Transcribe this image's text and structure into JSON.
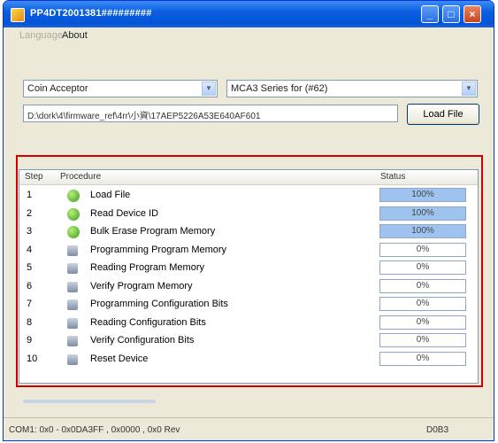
{
  "window": {
    "title": "PP4DT2001381#########"
  },
  "menu": {
    "items": [
      {
        "label": "Language",
        "enabled": false
      },
      {
        "label": "About",
        "enabled": true
      }
    ]
  },
  "device_type": {
    "value": "Coin Acceptor"
  },
  "device_model": {
    "value": "MCA3 Series for (#62)"
  },
  "file_path": {
    "value": "D:\\dork\\4\\firmware_ref\\4rr\\小資\\17AEP5226A53E640AF601"
  },
  "load_button": {
    "label": "Load File"
  },
  "table": {
    "headers": {
      "step": "Step",
      "procedure": "Procedure",
      "status": "Status"
    },
    "rows": [
      {
        "step": "1",
        "procedure": "Load File",
        "status": "100%",
        "state": "done"
      },
      {
        "step": "2",
        "procedure": "Read Device ID",
        "status": "100%",
        "state": "done"
      },
      {
        "step": "3",
        "procedure": "Bulk Erase Program Memory",
        "status": "100%",
        "state": "done"
      },
      {
        "step": "4",
        "procedure": "Programming Program Memory",
        "status": "0%",
        "state": "pending"
      },
      {
        "step": "5",
        "procedure": "Reading Program Memory",
        "status": "0%",
        "state": "pending"
      },
      {
        "step": "6",
        "procedure": "Verify Program Memory",
        "status": "0%",
        "state": "pending"
      },
      {
        "step": "7",
        "procedure": "Programming Configuration Bits",
        "status": "0%",
        "state": "pending"
      },
      {
        "step": "8",
        "procedure": "Reading Configuration Bits",
        "status": "0%",
        "state": "pending"
      },
      {
        "step": "9",
        "procedure": "Verify Configuration Bits",
        "status": "0%",
        "state": "pending"
      },
      {
        "step": "10",
        "procedure": "Reset Device",
        "status": "0%",
        "state": "pending"
      }
    ]
  },
  "statusbar": {
    "left": "COM1: 0x0 - 0x0DA3FF , 0x0000 , 0x0 Rev",
    "right": "D0B3"
  },
  "colors": {
    "titlebar": "#0553d8",
    "done_status": "#9ec3ee",
    "highlight_box": "#d10000"
  }
}
